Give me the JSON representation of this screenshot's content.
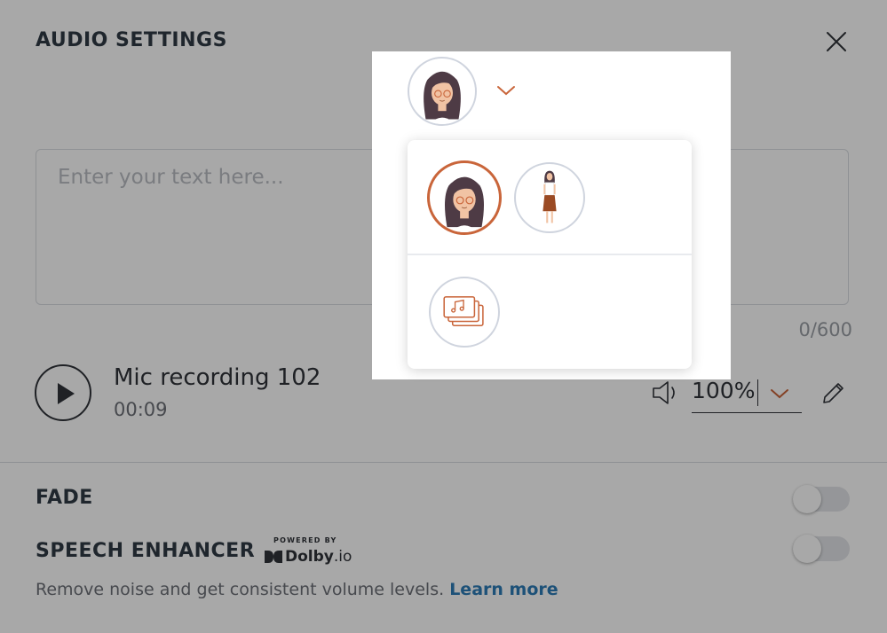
{
  "dialog": {
    "title": "AUDIO SETTINGS",
    "text_input": {
      "placeholder": "Enter your text here...",
      "value": ""
    },
    "char_counter": "0/600"
  },
  "recording": {
    "name": "Mic recording 102",
    "duration": "00:09",
    "volume": "100%"
  },
  "fade": {
    "label": "FADE",
    "enabled": false
  },
  "speech_enhancer": {
    "label": "SPEECH ENHANCER",
    "powered_by": "POWERED BY",
    "brand": "Dolby",
    "brand_suffix": ".io",
    "enabled": false,
    "description": "Remove noise and get consistent volume levels.",
    "learn_more": "Learn more"
  },
  "avatar_picker": {
    "selected": "character-head",
    "options": [
      "character-head",
      "character-full-body",
      "music-media"
    ]
  },
  "colors": {
    "accent": "#c9653a",
    "link": "#2c7cb6",
    "text": "#2f3339",
    "muted": "#6c7077",
    "avatar_border": "#cfd4de",
    "overlay": "rgba(0,0,0,0.34)"
  },
  "icons": {
    "close": "close-icon",
    "play": "play-icon",
    "speaker": "speaker-icon",
    "chevron": "chevron-down-icon",
    "edit": "pencil-icon",
    "music": "music-stack-icon"
  }
}
